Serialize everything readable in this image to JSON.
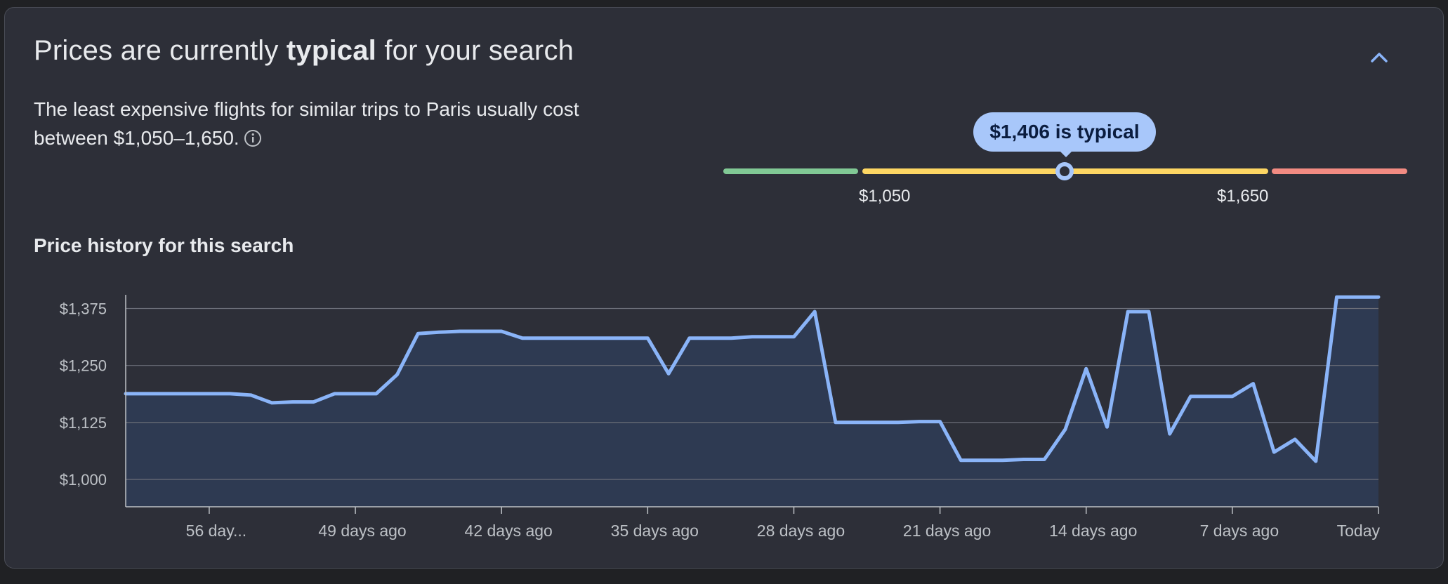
{
  "header": {
    "title_prefix": "Prices are currently ",
    "title_emphasis": "typical",
    "title_suffix": " for your search",
    "collapse_icon": "chevron-up-icon"
  },
  "summary": {
    "description": "The least expensive flights for similar trips to Paris usually cost between $1,050–1,650.",
    "info_icon": "info-icon"
  },
  "price_gauge": {
    "current_label": "$1,406 is typical",
    "current_price": 1406,
    "low_label": "$1,050",
    "high_label": "$1,650",
    "colors": {
      "low": "#81c995",
      "typical": "#fdd663",
      "high": "#f28b82",
      "marker": "#a8c7fa"
    }
  },
  "chart": {
    "title": "Price history for this search",
    "line_color": "#8ab4f8",
    "fill_color": "#2e3a52"
  },
  "chart_data": {
    "type": "area",
    "title": "Price history for this search",
    "xlabel": "",
    "ylabel": "",
    "ylim": [
      940,
      1405
    ],
    "yticks": [
      1000,
      1125,
      1250,
      1375
    ],
    "ytick_labels": [
      "$1,000",
      "$1,125",
      "$1,250",
      "$1,375"
    ],
    "xlim": [
      -60,
      0
    ],
    "xticks": [
      -56,
      -49,
      -42,
      -35,
      -28,
      -21,
      -14,
      -7,
      0
    ],
    "xtick_labels": [
      "56 day...",
      "49 days ago",
      "42 days ago",
      "35 days ago",
      "28 days ago",
      "21 days ago",
      "14 days ago",
      "7 days ago",
      "Today"
    ],
    "grid": true,
    "series": [
      {
        "x": [
          -60,
          -59,
          -58,
          -57,
          -56,
          -55,
          -54,
          -53,
          -52,
          -51,
          -50,
          -49,
          -48,
          -47,
          -46,
          -45,
          -44,
          -43,
          -42,
          -41,
          -40,
          -39,
          -38,
          -37,
          -36,
          -35,
          -34,
          -33,
          -32,
          -31,
          -30,
          -29,
          -28,
          -27,
          -26,
          -25,
          -24,
          -23,
          -22,
          -21,
          -20,
          -19,
          -18,
          -17,
          -16,
          -15,
          -14,
          -13,
          -12,
          -11,
          -10,
          -9,
          -8,
          -7,
          -6,
          -5,
          -4,
          -3,
          -2,
          -1,
          0
        ],
        "y": [
          1188,
          1188,
          1188,
          1188,
          1188,
          1188,
          1185,
          1168,
          1170,
          1170,
          1188,
          1188,
          1188,
          1230,
          1320,
          1323,
          1325,
          1325,
          1325,
          1310,
          1310,
          1310,
          1310,
          1310,
          1310,
          1310,
          1232,
          1310,
          1310,
          1310,
          1313,
          1313,
          1313,
          1368,
          1125,
          1125,
          1125,
          1125,
          1127,
          1127,
          1042,
          1042,
          1042,
          1044,
          1044,
          1110,
          1243,
          1115,
          1368,
          1368,
          1100,
          1182,
          1182,
          1182,
          1210,
          1060,
          1088,
          1040,
          1400,
          1400,
          1400
        ]
      }
    ]
  }
}
